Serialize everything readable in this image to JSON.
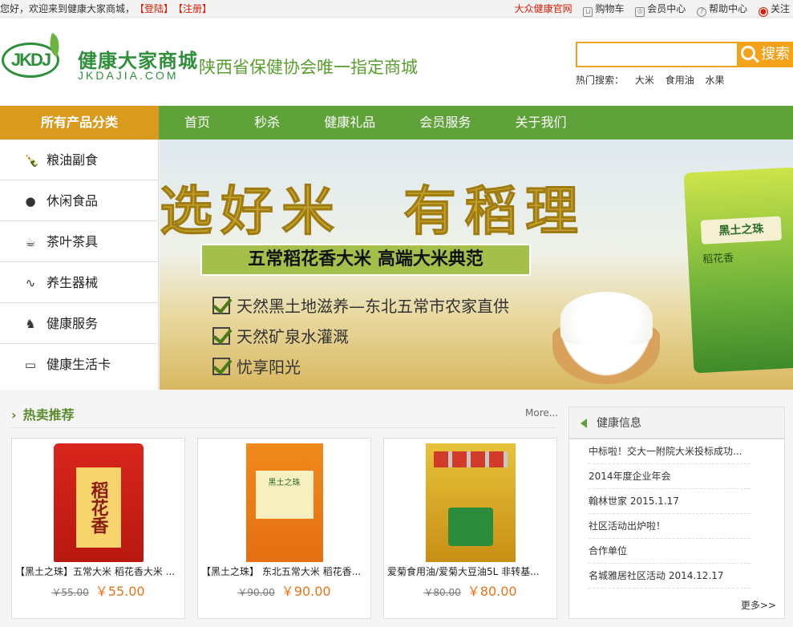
{
  "topbar": {
    "welcome": "您好，欢迎来到健康大家商城，",
    "login": "【登陆】",
    "register": "【注册】",
    "official": "大众健康官网",
    "cart": "购物车",
    "member": "会员中心",
    "help": "帮助中心",
    "follow": "关注"
  },
  "header": {
    "logo_badge": "JKDJ",
    "logo_cn": "健康大家商城",
    "logo_en": "JKDAJIA.COM",
    "slogan": "陕西省保健协会唯一指定商城",
    "search_value": "",
    "search_button": "搜索",
    "hot_label": "热门搜索：",
    "hot_terms": [
      "大米",
      "食用油",
      "水果"
    ]
  },
  "nav": {
    "category_label": "所有产品分类",
    "links": [
      "首页",
      "秒杀",
      "健康礼品",
      "会员服务",
      "关于我们"
    ]
  },
  "sidebar": {
    "items": [
      {
        "label": "粮油副食",
        "icon": "bottle-icon"
      },
      {
        "label": "休闲食品",
        "icon": "apple-icon"
      },
      {
        "label": "茶叶茶具",
        "icon": "tea-icon"
      },
      {
        "label": "养生器械",
        "icon": "stethoscope-icon"
      },
      {
        "label": "健康服务",
        "icon": "health-service-icon"
      },
      {
        "label": "健康生活卡",
        "icon": "card-icon"
      }
    ]
  },
  "banner": {
    "headline": "选好米　有稻理",
    "band": "五常稻花香大米 高端大米典范",
    "features": [
      "天然黑土地滋养—东北五常市农家直供",
      "天然矿泉水灌溉",
      "忧享阳光"
    ],
    "bag_brand": "黑土之珠",
    "bag_variety": "稻花香"
  },
  "hot": {
    "title": "热卖推荐",
    "more": "More...",
    "products": [
      {
        "name": "【黑土之珠】五常大米 稻花香大米 ...",
        "old_price": "￥55.00",
        "price": "￥55.00",
        "image_text": "稻花香"
      },
      {
        "name": "【黑土之珠】 东北五常大米 稻花香...",
        "old_price": "￥90.00",
        "price": "￥90.00",
        "image_text": "黑土之珠"
      },
      {
        "name": "爱菊食用油/爱菊大豆油5L 非转基...",
        "old_price": "￥80.00",
        "price": "￥80.00"
      }
    ]
  },
  "news": {
    "title": "健康信息",
    "items": [
      "中标啦！交大一附院大米投标成功...",
      "2014年度企业年会",
      "翰林世家 2015.1.17",
      "社区活动出炉啦！",
      "合作单位",
      "名城雅居社区活动 2014.12.17"
    ],
    "more": "更多>>"
  },
  "colors": {
    "green": "#5fa23a",
    "orange": "#d99a1e",
    "price": "#e8731a",
    "red": "#d81e06"
  }
}
